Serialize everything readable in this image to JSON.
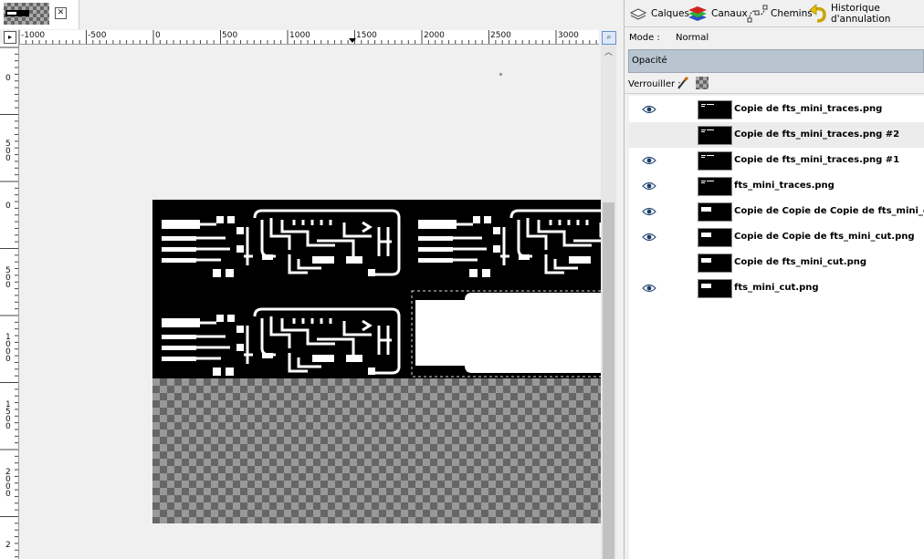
{
  "ruler": {
    "top": [
      "-1000",
      "-500",
      "0",
      "500",
      "1000",
      "1500",
      "2000",
      "2500",
      "3000"
    ],
    "left": [
      "0",
      "500",
      "0",
      "500",
      "1000",
      "1500",
      "2000",
      "2"
    ]
  },
  "tabs": [
    {
      "label": "Calques",
      "icon": "layers-icon"
    },
    {
      "label": "Canaux",
      "icon": "channels-icon"
    },
    {
      "label": "Chemins",
      "icon": "paths-icon"
    },
    {
      "label": "Historique d'annulation",
      "icon": "undo-icon"
    }
  ],
  "mode": {
    "label": "Mode :",
    "value": "Normal"
  },
  "opacity": {
    "label": "Opacité"
  },
  "lock": {
    "label": "Verrouiller :"
  },
  "layers": [
    {
      "name": "Copie de fts_mini_traces.png",
      "visible": true,
      "thumb": "traces",
      "selected": false
    },
    {
      "name": "Copie de fts_mini_traces.png #2",
      "visible": false,
      "thumb": "traces",
      "selected": true
    },
    {
      "name": "Copie de fts_mini_traces.png #1",
      "visible": true,
      "thumb": "traces",
      "selected": false
    },
    {
      "name": "fts_mini_traces.png",
      "visible": true,
      "thumb": "traces",
      "selected": false
    },
    {
      "name": "Copie de Copie de Copie de fts_mini_cut.png",
      "visible": true,
      "thumb": "cut",
      "selected": false
    },
    {
      "name": "Copie de Copie de fts_mini_cut.png",
      "visible": true,
      "thumb": "cut",
      "selected": false
    },
    {
      "name": "Copie de fts_mini_cut.png",
      "visible": false,
      "thumb": "cut",
      "selected": false
    },
    {
      "name": "fts_mini_cut.png",
      "visible": true,
      "thumb": "cut",
      "selected": false
    }
  ]
}
